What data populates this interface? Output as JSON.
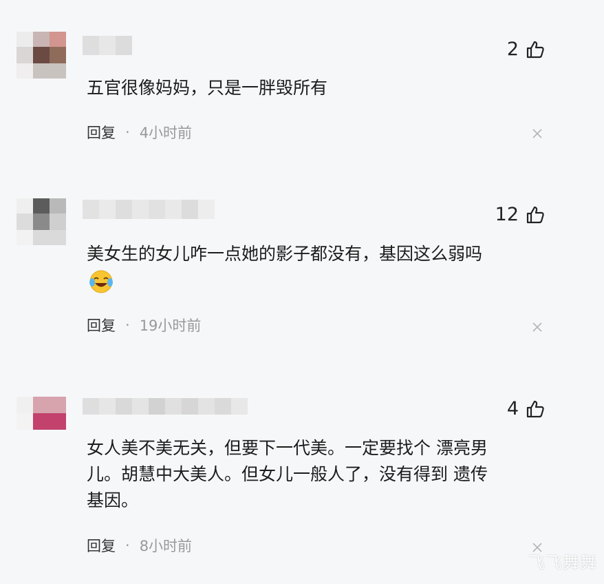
{
  "comments": [
    {
      "likes": "2",
      "text": "五官很像妈妈，只是一胖毁所有",
      "reply": "回复",
      "separator": "·",
      "time": "4小时前",
      "emoji": ""
    },
    {
      "likes": "12",
      "text": "美女生的女儿咋一点她的影子都没有，基因这么弱吗",
      "reply": "回复",
      "separator": "·",
      "time": "19小时前",
      "emoji": "laughing-crying-emoji"
    },
    {
      "likes": "4",
      "text": "女人美不美无关，但要下一代美。一定要找个 漂亮男\n儿。胡慧中大美人。但女儿一般人了，没有得到 遗传\n基因。",
      "reply": "回复",
      "separator": "·",
      "time": "8小时前",
      "emoji": ""
    }
  ],
  "watermark": "飞飞舞舞",
  "colors": {
    "background": "#f6f7f9",
    "text": "#1c1c1c",
    "muted": "#999999"
  }
}
